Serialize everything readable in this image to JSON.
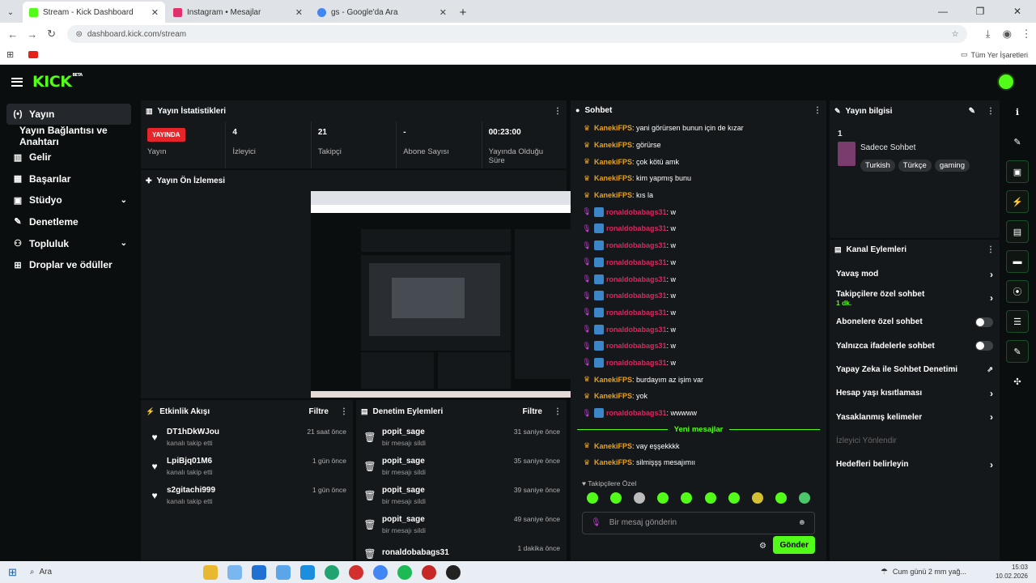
{
  "browser": {
    "tabs": [
      {
        "title": "Stream - Kick Dashboard",
        "icon": "kick-icon",
        "color": "#53fc18"
      },
      {
        "title": "Instagram • Mesajlar",
        "icon": "instagram-icon",
        "color": "#e1306c"
      },
      {
        "title": "gs - Google'da Ara",
        "icon": "google-icon",
        "color": "#4285f4"
      }
    ],
    "url": "dashboard.kick.com/stream",
    "bookmarks_label": "Tüm Yer İşaretleri"
  },
  "app": {
    "logo": "KICK",
    "beta": "BETA",
    "accent": "#53fc18",
    "nav": [
      {
        "label": "Yayın",
        "icon": "broadcast-icon",
        "active": true
      },
      {
        "label": "Yayın Bağlantısı ve Anahtarı",
        "icon": "",
        "active": false
      },
      {
        "label": "Gelir",
        "icon": "chart-icon",
        "active": false
      },
      {
        "label": "Başarılar",
        "icon": "grid-icon",
        "active": false
      },
      {
        "label": "Stüdyo",
        "icon": "studio-icon",
        "active": false,
        "chevron": true
      },
      {
        "label": "Denetleme",
        "icon": "wrench-icon",
        "active": false
      },
      {
        "label": "Topluluk",
        "icon": "people-icon",
        "active": false,
        "chevron": true
      },
      {
        "label": "Droplar ve ödüller",
        "icon": "gift-icon",
        "active": false
      }
    ]
  },
  "stats": {
    "title": "Yayın İstatistikleri",
    "items": [
      {
        "value": "YAYINDA",
        "label": "Yayın"
      },
      {
        "value": "4",
        "label": "İzleyici"
      },
      {
        "value": "21",
        "label": "Takipçi"
      },
      {
        "value": "-",
        "label": "Abone Sayısı"
      },
      {
        "value": "00:23:00",
        "label": "Yayında Olduğu Süre"
      }
    ]
  },
  "preview": {
    "title": "Yayın Ön İzlemesi"
  },
  "activity": {
    "title": "Etkinlik Akışı",
    "filter": "Filtre",
    "items": [
      {
        "name": "DT1hDkWJou",
        "sub": "kanalı takip etti",
        "time": "21 saat önce"
      },
      {
        "name": "LpiBjq01M6",
        "sub": "kanalı takip etti",
        "time": "1 gün önce"
      },
      {
        "name": "s2gitachi999",
        "sub": "kanalı takip etti",
        "time": "1 gün önce"
      }
    ]
  },
  "moderation": {
    "title": "Denetim Eylemleri",
    "filter": "Filtre",
    "items": [
      {
        "name": "popit_sage",
        "sub": "bir mesajı sildi",
        "time": "31 saniye önce"
      },
      {
        "name": "popit_sage",
        "sub": "bir mesajı sildi",
        "time": "35 saniye önce"
      },
      {
        "name": "popit_sage",
        "sub": "bir mesajı sildi",
        "time": "39 saniye önce"
      },
      {
        "name": "popit_sage",
        "sub": "bir mesajı sildi",
        "time": "49 saniye önce"
      },
      {
        "name": "ronaldobabags31",
        "sub": "",
        "time": "1 dakika önce"
      }
    ]
  },
  "chat": {
    "title": "Sohbet",
    "messages": [
      {
        "user": "KanekiFPS",
        "text": ": yani görürsen bunun için de kızar",
        "kind": "crown"
      },
      {
        "user": "KanekiFPS",
        "text": ": görürse",
        "kind": "crown"
      },
      {
        "user": "KanekiFPS",
        "text": ": çok kötü amk",
        "kind": "crown"
      },
      {
        "user": "KanekiFPS",
        "text": ": kim yapmış bunu",
        "kind": "crown"
      },
      {
        "user": "KanekiFPS",
        "text": ": kıs la",
        "kind": "crown"
      },
      {
        "user": "ronaldobabags31",
        "text": ": w",
        "kind": "mic"
      },
      {
        "user": "ronaldobabags31",
        "text": ": w",
        "kind": "mic"
      },
      {
        "user": "ronaldobabags31",
        "text": ": w",
        "kind": "mic"
      },
      {
        "user": "ronaldobabags31",
        "text": ": w",
        "kind": "mic"
      },
      {
        "user": "ronaldobabags31",
        "text": ": w",
        "kind": "mic"
      },
      {
        "user": "ronaldobabags31",
        "text": ": w",
        "kind": "mic"
      },
      {
        "user": "ronaldobabags31",
        "text": ": w",
        "kind": "mic"
      },
      {
        "user": "ronaldobabags31",
        "text": ": w",
        "kind": "mic"
      },
      {
        "user": "ronaldobabags31",
        "text": ": w",
        "kind": "mic"
      },
      {
        "user": "ronaldobabags31",
        "text": ": w",
        "kind": "mic"
      },
      {
        "user": "KanekiFPS",
        "text": ": burdayım az işim var",
        "kind": "crown"
      },
      {
        "user": "KanekiFPS",
        "text": ": yok",
        "kind": "crown"
      },
      {
        "user": "ronaldobabags31",
        "text": ": wwwww",
        "kind": "mic"
      }
    ],
    "new_label": "Yeni mesajlar",
    "new_messages": [
      {
        "user": "KanekiFPS",
        "text": ":  vay eşşekkkk",
        "kind": "crown"
      },
      {
        "user": "KanekiFPS",
        "text": ": silmişşş mesajımıı",
        "kind": "crown"
      }
    ],
    "followers_only": "Takipçilere Özel",
    "placeholder": "Bir mesaj gönderin",
    "send": "Gönder"
  },
  "stream_info": {
    "title": "Yayın bilgisi",
    "count": "1",
    "category": "Sadece Sohbet",
    "tags": [
      "Turkish",
      "Türkçe",
      "gaming"
    ]
  },
  "channel_actions": {
    "title": "Kanal Eylemleri",
    "items": [
      {
        "label": "Yavaş mod",
        "control": "chevron"
      },
      {
        "label": "Takipçilere özel sohbet",
        "sub": "1 dk.",
        "control": "chevron"
      },
      {
        "label": "Abonelere özel sohbet",
        "control": "toggle"
      },
      {
        "label": "Yalnızca ifadelerle sohbet",
        "control": "toggle"
      },
      {
        "label": "Yapay Zeka ile Sohbet Denetimi",
        "control": "external"
      },
      {
        "label": "Hesap yaşı kısıtlaması",
        "control": "chevron"
      },
      {
        "label": "Yasaklanmış kelimeler",
        "control": "chevron"
      },
      {
        "label": "İzleyici Yönlendir",
        "control": "none",
        "disabled": true
      },
      {
        "label": "Hedefleri belirleyin",
        "control": "chevron"
      }
    ]
  },
  "taskbar": {
    "search": "Ara",
    "weather": "Cum günü 2 mm yağ...",
    "time": "15:03",
    "date": "10.02.2026"
  }
}
